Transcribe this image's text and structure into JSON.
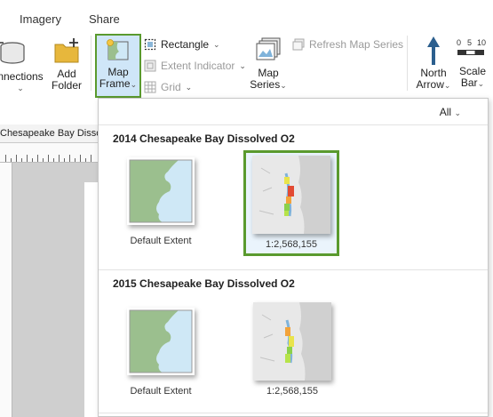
{
  "ribbon": {
    "tabs": [
      "Imagery",
      "Share"
    ],
    "connections_label": "nnections",
    "add_folder_label": [
      "Add",
      "Folder"
    ],
    "map_frame_label": [
      "Map",
      "Frame"
    ],
    "rectangle_label": "Rectangle",
    "extent_indicator_label": "Extent Indicator",
    "grid_label": "Grid",
    "map_series_label": [
      "Map",
      "Series"
    ],
    "refresh_map_series_label": "Refresh Map Series",
    "north_arrow_label": [
      "North",
      "Arrow"
    ],
    "scale_bar_label": [
      "Scale",
      "Bar"
    ],
    "scale_bar_ticks": [
      "0",
      "5",
      "10"
    ]
  },
  "view": {
    "tab_label": "Chesapeake Bay Dissol"
  },
  "gallery": {
    "filter_label": "All",
    "sections": [
      {
        "title": "2014 Chesapeake Bay Dissolved O2",
        "items": [
          {
            "caption": "Default Extent",
            "selected": false
          },
          {
            "caption": "1:2,568,155",
            "selected": true
          }
        ]
      },
      {
        "title": "2015 Chesapeake Bay Dissolved O2",
        "items": [
          {
            "caption": "Default Extent",
            "selected": false
          },
          {
            "caption": "1:2,568,155",
            "selected": false
          }
        ]
      }
    ]
  },
  "colors": {
    "selection_border": "#5a9a2e",
    "selection_fill": "#cfe6f8",
    "land_green": "#9bbf8e",
    "water_blue": "#cfe8f6"
  }
}
